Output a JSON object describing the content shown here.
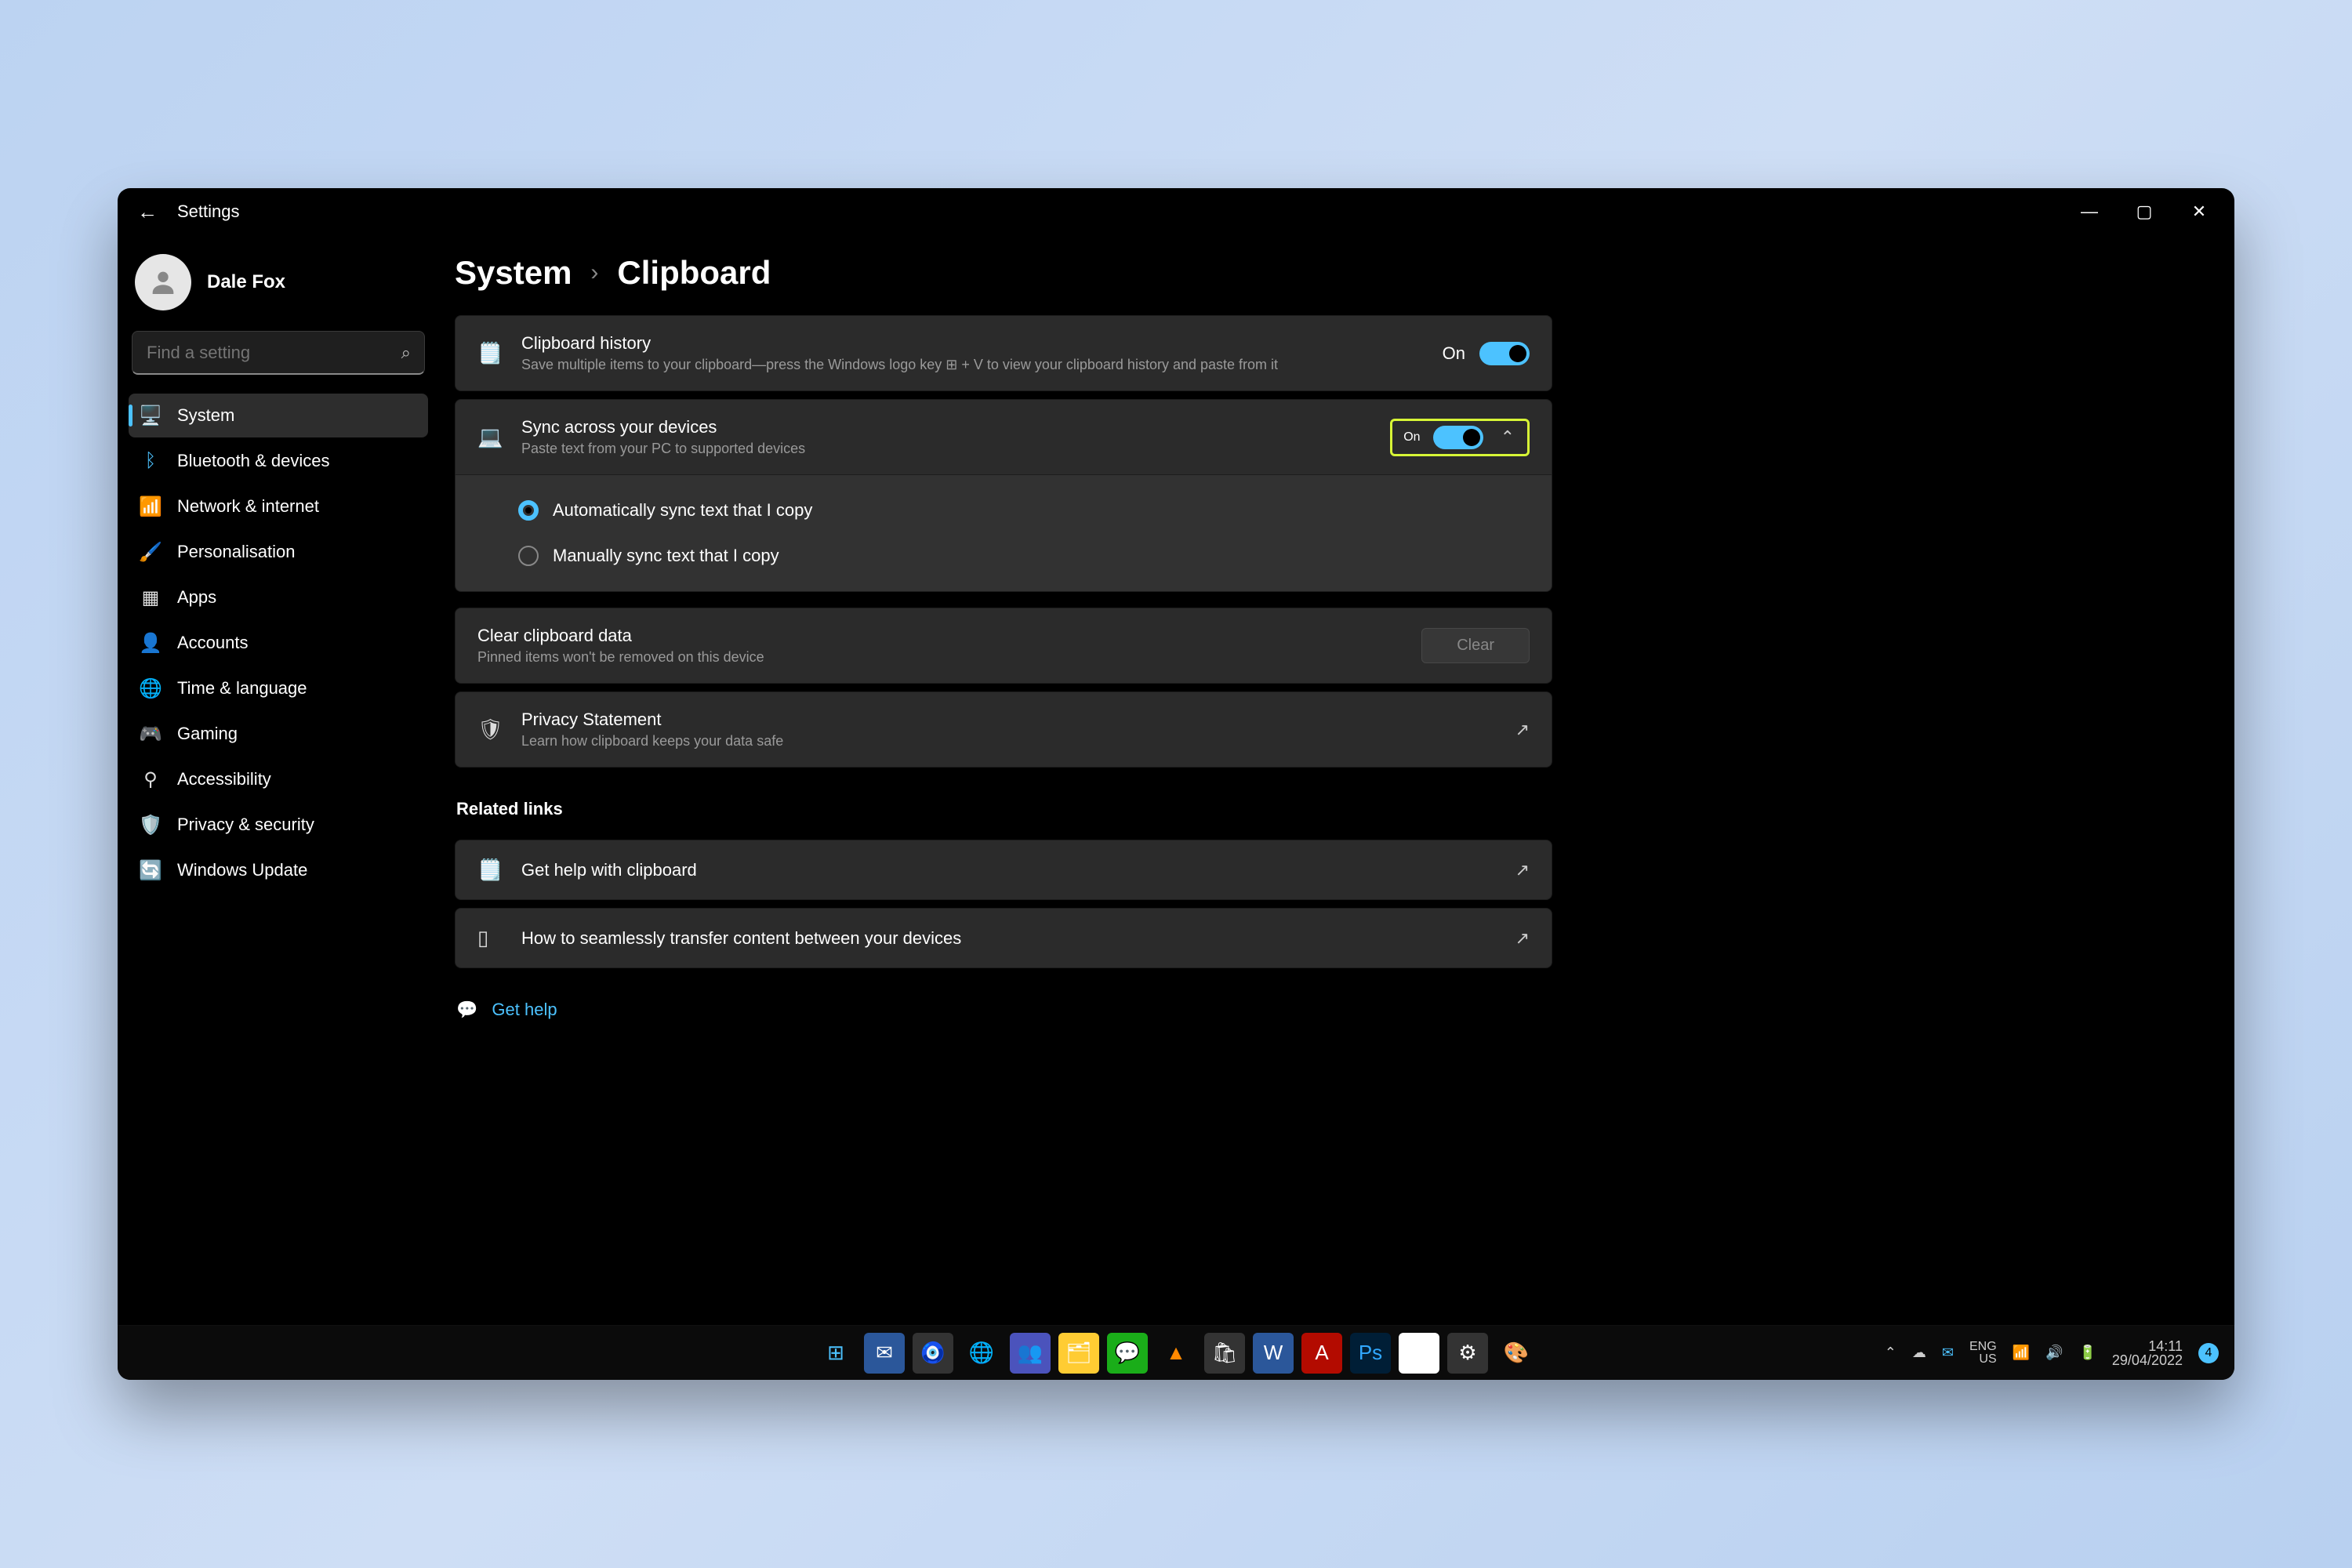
{
  "titlebar": {
    "app": "Settings"
  },
  "user": {
    "name": "Dale Fox"
  },
  "search": {
    "placeholder": "Find a setting"
  },
  "sidebar": {
    "items": [
      {
        "label": "System",
        "icon": "🖥️",
        "active": true
      },
      {
        "label": "Bluetooth & devices",
        "icon": "ᛒ",
        "color": "#4cc2ff"
      },
      {
        "label": "Network & internet",
        "icon": "📶",
        "color": "#4cc2ff"
      },
      {
        "label": "Personalisation",
        "icon": "🖌️"
      },
      {
        "label": "Apps",
        "icon": "▦"
      },
      {
        "label": "Accounts",
        "icon": "👤"
      },
      {
        "label": "Time & language",
        "icon": "🌐"
      },
      {
        "label": "Gaming",
        "icon": "🎮"
      },
      {
        "label": "Accessibility",
        "icon": "⚲"
      },
      {
        "label": "Privacy & security",
        "icon": "🛡️"
      },
      {
        "label": "Windows Update",
        "icon": "🔄",
        "color": "#4cc2ff"
      }
    ]
  },
  "breadcrumb": {
    "root": "System",
    "leaf": "Clipboard"
  },
  "cards": {
    "history": {
      "title": "Clipboard history",
      "desc": "Save multiple items to your clipboard—press the Windows logo key ⊞ + V to view your clipboard history and paste from it",
      "state": "On"
    },
    "sync": {
      "title": "Sync across your devices",
      "desc": "Paste text from your PC to supported devices",
      "state": "On",
      "options": [
        {
          "label": "Automatically sync text that I copy",
          "checked": true
        },
        {
          "label": "Manually sync text that I copy",
          "checked": false
        }
      ]
    },
    "clear": {
      "title": "Clear clipboard data",
      "desc": "Pinned items won't be removed on this device",
      "button": "Clear"
    },
    "privacy": {
      "title": "Privacy Statement",
      "desc": "Learn how clipboard keeps your data safe"
    }
  },
  "related": {
    "heading": "Related links",
    "links": [
      {
        "label": "Get help with clipboard"
      },
      {
        "label": "How to seamlessly transfer content between your devices"
      }
    ]
  },
  "gethelp": {
    "label": "Get help"
  },
  "taskbar": {
    "tray": {
      "lang1": "ENG",
      "lang2": "US",
      "time": "14:11",
      "date": "29/04/2022",
      "notif": "4"
    }
  }
}
